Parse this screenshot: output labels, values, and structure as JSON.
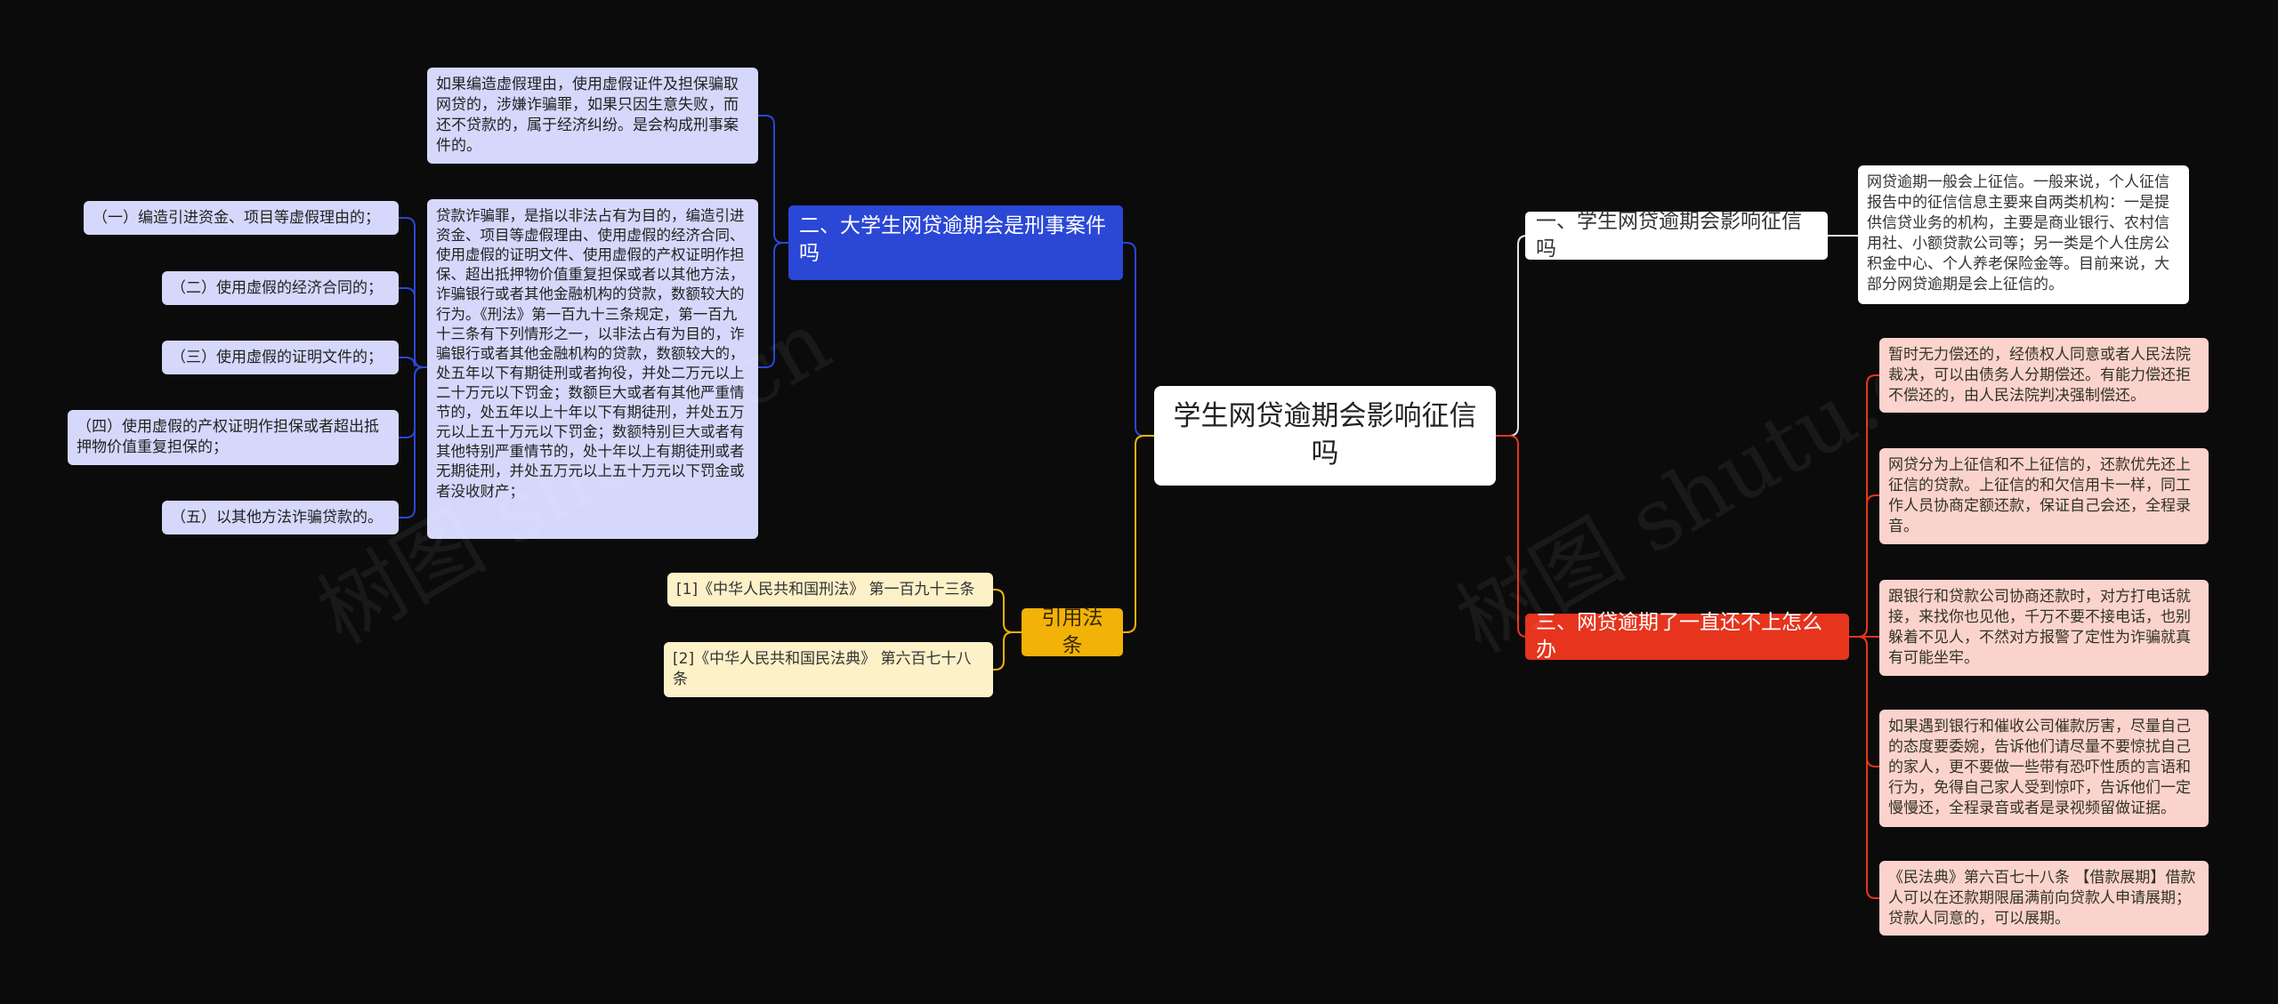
{
  "root": {
    "label": "学生网贷逾期会影响征信吗"
  },
  "branches": {
    "b1": {
      "label": "一、学生网贷逾期会影响征信吗",
      "details": [
        "网贷逾期一般会上征信。一般来说，个人征信报告中的征信信息主要来自两类机构：一是提供信贷业务的机构，主要是商业银行、农村信用社、小额贷款公司等；另一类是个人住房公积金中心、个人养老保险金等。目前来说，大部分网贷逾期是会上征信的。"
      ]
    },
    "b2": {
      "label": "二、大学生网贷逾期会是刑事案件吗",
      "details": [
        "如果编造虚假理由，使用虚假证件及担保骗取网贷的，涉嫌诈骗罪，如果只因生意失败，而还不贷款的，属于经济纠纷。是会构成刑事案件的。",
        "贷款诈骗罪，是指以非法占有为目的，编造引进资金、项目等虚假理由、使用虚假的经济合同、使用虚假的证明文件、使用虚假的产权证明作担保、超出抵押物价值重复担保或者以其他方法，诈骗银行或者其他金融机构的贷款，数额较大的行为。《刑法》第一百九十三条规定，第一百九十三条有下列情形之一，以非法占有为目的，诈骗银行或者其他金融机构的贷款，数额较大的，处五年以下有期徒刑或者拘役，并处二万元以上二十万元以下罚金；数额巨大或者有其他严重情节的，处五年以上十年以下有期徒刑，并处五万元以上五十万元以下罚金；数额特别巨大或者有其他特别严重情节的，处十年以上有期徒刑或者无期徒刑，并处五万元以上五十万元以下罚金或者没收财产；"
      ],
      "sub_items": [
        "（一）编造引进资金、项目等虚假理由的；",
        "（二）使用虚假的经济合同的；",
        "（三）使用虚假的证明文件的；",
        "（四）使用虚假的产权证明作担保或者超出抵押物价值重复担保的；",
        "（五）以其他方法诈骗贷款的。"
      ]
    },
    "b3": {
      "label": "三、网贷逾期了一直还不上怎么办",
      "details": [
        "暂时无力偿还的，经债权人同意或者人民法院裁决，可以由债务人分期偿还。有能力偿还拒不偿还的，由人民法院判决强制偿还。",
        "网贷分为上征信和不上征信的，还款优先还上征信的贷款。上征信的和欠信用卡一样，同工作人员协商定额还款，保证自己会还，全程录音。",
        "跟银行和贷款公司协商还款时，对方打电话就接，来找你也见他，千万不要不接电话，也别躲着不见人，不然对方报警了定性为诈骗就真有可能坐牢。",
        "如果遇到银行和催收公司催款厉害，尽量自己的态度要委婉，告诉他们请尽量不要惊扰自己的家人，更不要做一些带有恐吓性质的言语和行为，免得自己家人受到惊吓，告诉他们一定慢慢还，全程录音或者是录视频留做证据。",
        "《民法典》第六百七十八条 【借款展期】借款人可以在还款期限届满前向贷款人申请展期；贷款人同意的，可以展期。"
      ]
    },
    "b4": {
      "label": "引用法条",
      "details": [
        "[1]《中华人民共和国刑法》 第一百九十三条",
        "[2]《中华人民共和国民法典》 第六百七十八条"
      ]
    }
  },
  "watermarks": [
    "树图 shutu.cn",
    "树图 shutu.cn"
  ],
  "colors": {
    "background": "#0b0b0b",
    "line_white": "#e6e6e6",
    "line_blue": "#2a47d6",
    "line_red": "#e7341d",
    "line_yellow": "#f2b208"
  }
}
